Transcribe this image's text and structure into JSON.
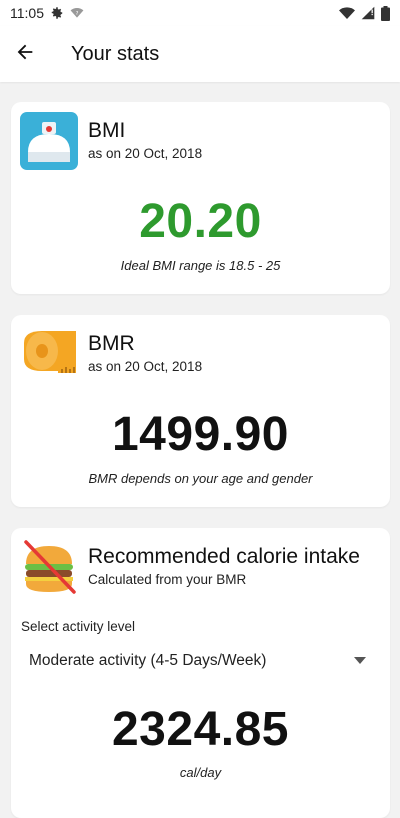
{
  "status_bar": {
    "time": "11:05",
    "icons": [
      "gear-icon",
      "wifi-question-icon",
      "wifi-icon",
      "signal-icon",
      "battery-icon"
    ]
  },
  "app_bar": {
    "title": "Your stats",
    "back_icon": "arrow-back-icon"
  },
  "bmi_card": {
    "icon": "scale-icon",
    "title": "BMI",
    "subtitle": "as on 20 Oct, 2018",
    "value": "20.20",
    "value_color": "#2e9a2e",
    "caption": "Ideal BMI range is 18.5 - 25"
  },
  "bmr_card": {
    "icon": "tape-measure-icon",
    "title": "BMR",
    "subtitle": "as on 20 Oct, 2018",
    "value": "1499.90",
    "caption": "BMR depends on your age and gender"
  },
  "calorie_card": {
    "icon": "burger-crossed-icon",
    "title": "Recommended calorie intake",
    "subtitle": "Calculated from your BMR",
    "select_label": "Select activity level",
    "activity_selected": "Moderate activity (4-5 Days/Week)",
    "value": "2324.85",
    "unit": "cal/day"
  },
  "colors": {
    "background": "#f2f2f2",
    "card": "#ffffff",
    "bmi_green": "#2e9a2e",
    "scale_blue": "#3ab0d8",
    "tape_orange": "#f4a623",
    "burger_bun": "#f2a93b",
    "cross_red": "#e53935"
  }
}
